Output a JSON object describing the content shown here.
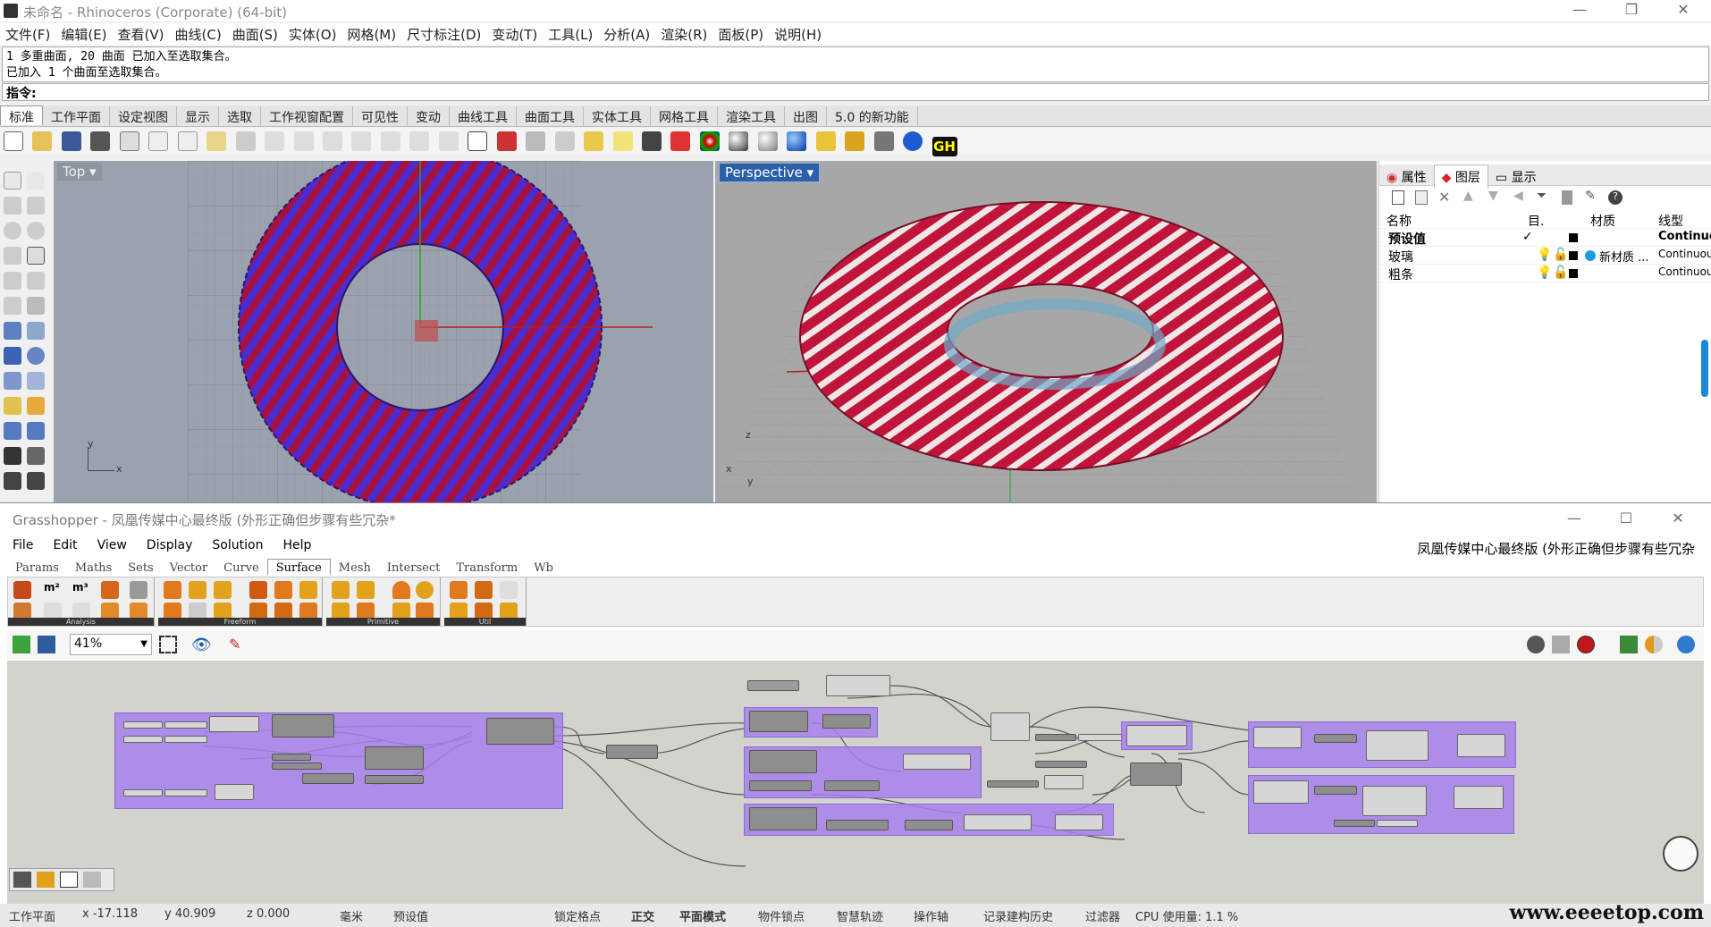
{
  "rhino": {
    "title": "未命名 - Rhinoceros (Corporate) (64-bit)",
    "menu": [
      "文件(F)",
      "编辑(E)",
      "查看(V)",
      "曲线(C)",
      "曲面(S)",
      "实体(O)",
      "网格(M)",
      "尺寸标注(D)",
      "变动(T)",
      "工具(L)",
      "分析(A)",
      "渲染(R)",
      "面板(P)",
      "说明(H)"
    ],
    "history": [
      "1 多重曲面, 20 曲面 已加入至选取集合。",
      "已加入 1 个曲面至选取集合。"
    ],
    "command_prompt": "指令:",
    "toolbar_tabs": [
      "标准",
      "工作平面",
      "设定视图",
      "显示",
      "选取",
      "工作视窗配置",
      "可见性",
      "变动",
      "曲线工具",
      "曲面工具",
      "实体工具",
      "网格工具",
      "渲染工具",
      "出图",
      "5.0 的新功能"
    ],
    "gh_icon_label": "GH",
    "viewports": {
      "top_label": "Top",
      "persp_label": "Perspective",
      "axis_y": "y",
      "axis_x": "x",
      "axis_z": "z"
    },
    "panel": {
      "tabs": [
        "属性",
        "图层",
        "显示"
      ],
      "columns": {
        "name": "名称",
        "flag": "目.",
        "material": "材质",
        "linetype": "线型"
      },
      "layers": [
        {
          "name": "预设值",
          "check": "✓",
          "material": "",
          "linetype": "Continuo",
          "bold": true
        },
        {
          "name": "玻璃",
          "check": "",
          "material": "新材质 ...",
          "linetype": "Continuou",
          "bold": false
        },
        {
          "name": "粗条",
          "check": "",
          "material": "",
          "linetype": "Continuou",
          "bold": false
        }
      ]
    }
  },
  "grasshopper": {
    "title": "Grasshopper - 凤凰传媒中心最终版 (外形正确但步骤有些冗杂*",
    "menu": [
      "File",
      "Edit",
      "View",
      "Display",
      "Solution",
      "Help"
    ],
    "doc_name": "凤凰传媒中心最终版 (外形正确但步骤有些冗杂",
    "tabs": [
      "Params",
      "Maths",
      "Sets",
      "Vector",
      "Curve",
      "Surface",
      "Mesh",
      "Intersect",
      "Transform",
      "Wb"
    ],
    "active_tab": "Surface",
    "ribbon_groups": [
      "Analysis",
      "Freeform",
      "Primitive",
      "Util"
    ],
    "zoom": "41%",
    "status_items": [
      "工作平面",
      "x -17.118",
      "y 40.909",
      "z 0.000",
      "毫米",
      "预设值",
      "锁定格点",
      "正交",
      "平面模式",
      "物件锁点",
      "智慧轨迹",
      "操作轴",
      "记录建构历史",
      "过滤器",
      "CPU 使用量: 1.1 %"
    ]
  },
  "watermark": "www.eeeetop.com",
  "colors": {
    "torus_blue": "#4a2bd0",
    "torus_red": "#b3123a",
    "group_purple": "#a680eb",
    "viewport_top_bg": "#9aa3ad",
    "viewport_persp_bg": "#a7a7a7"
  }
}
